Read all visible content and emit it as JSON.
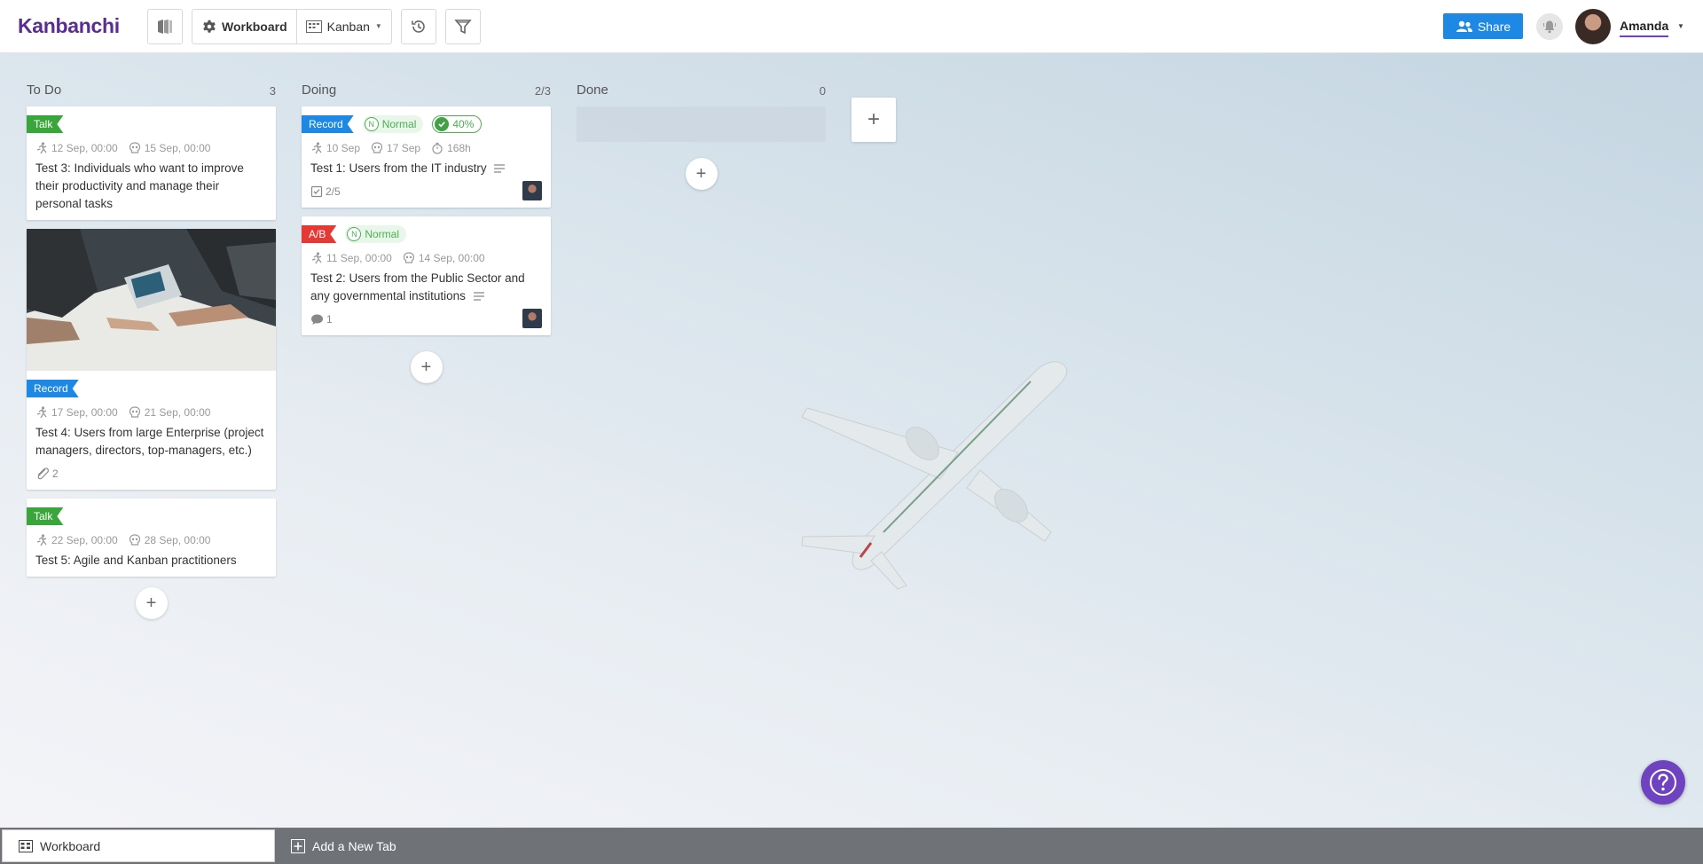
{
  "header": {
    "logo": "Kanbanchi",
    "workboard_label": "Workboard",
    "view_label": "Kanban",
    "share_label": "Share",
    "user_name": "Amanda"
  },
  "columns": [
    {
      "name": "To Do",
      "count": "3",
      "cards": [
        {
          "tag": "Talk",
          "start": "12 Sep, 00:00",
          "due": "15 Sep, 00:00",
          "title": "Test 3: Individuals who want to improve their productivity and manage their personal tasks"
        },
        {
          "tag": "Record",
          "start": "17 Sep, 00:00",
          "due": "21 Sep, 00:00",
          "title": "Test 4: Users from large Enterprise (project managers, directors, top-managers, etc.)",
          "attachments": "2"
        },
        {
          "tag": "Talk",
          "start": "22 Sep, 00:00",
          "due": "28 Sep, 00:00",
          "title": "Test 5: Agile and Kanban practitioners"
        }
      ]
    },
    {
      "name": "Doing",
      "count": "2/3",
      "cards": [
        {
          "tag": "Record",
          "priority": "Normal",
          "priority_letter": "N",
          "progress": "40%",
          "start": "10 Sep",
          "due": "17 Sep",
          "estimate": "168h",
          "title": "Test 1: Users from the IT industry",
          "checklist": "2/5"
        },
        {
          "tag": "A/B",
          "priority": "Normal",
          "priority_letter": "N",
          "start": "11 Sep, 00:00",
          "due": "14 Sep, 00:00",
          "title": "Test 2: Users from the Public Sector and any governmental institutions",
          "comments": "1"
        }
      ]
    },
    {
      "name": "Done",
      "count": "0"
    }
  ],
  "bottom_tabs": {
    "active": "Workboard",
    "add_new": "Add a New Tab"
  },
  "colors": {
    "brand": "#5a2d91",
    "share": "#1e88e5",
    "talk": "#3aa53a",
    "record": "#1e88e5",
    "ab": "#e53935",
    "priority": "#4caf50",
    "help": "#6f42c1"
  }
}
